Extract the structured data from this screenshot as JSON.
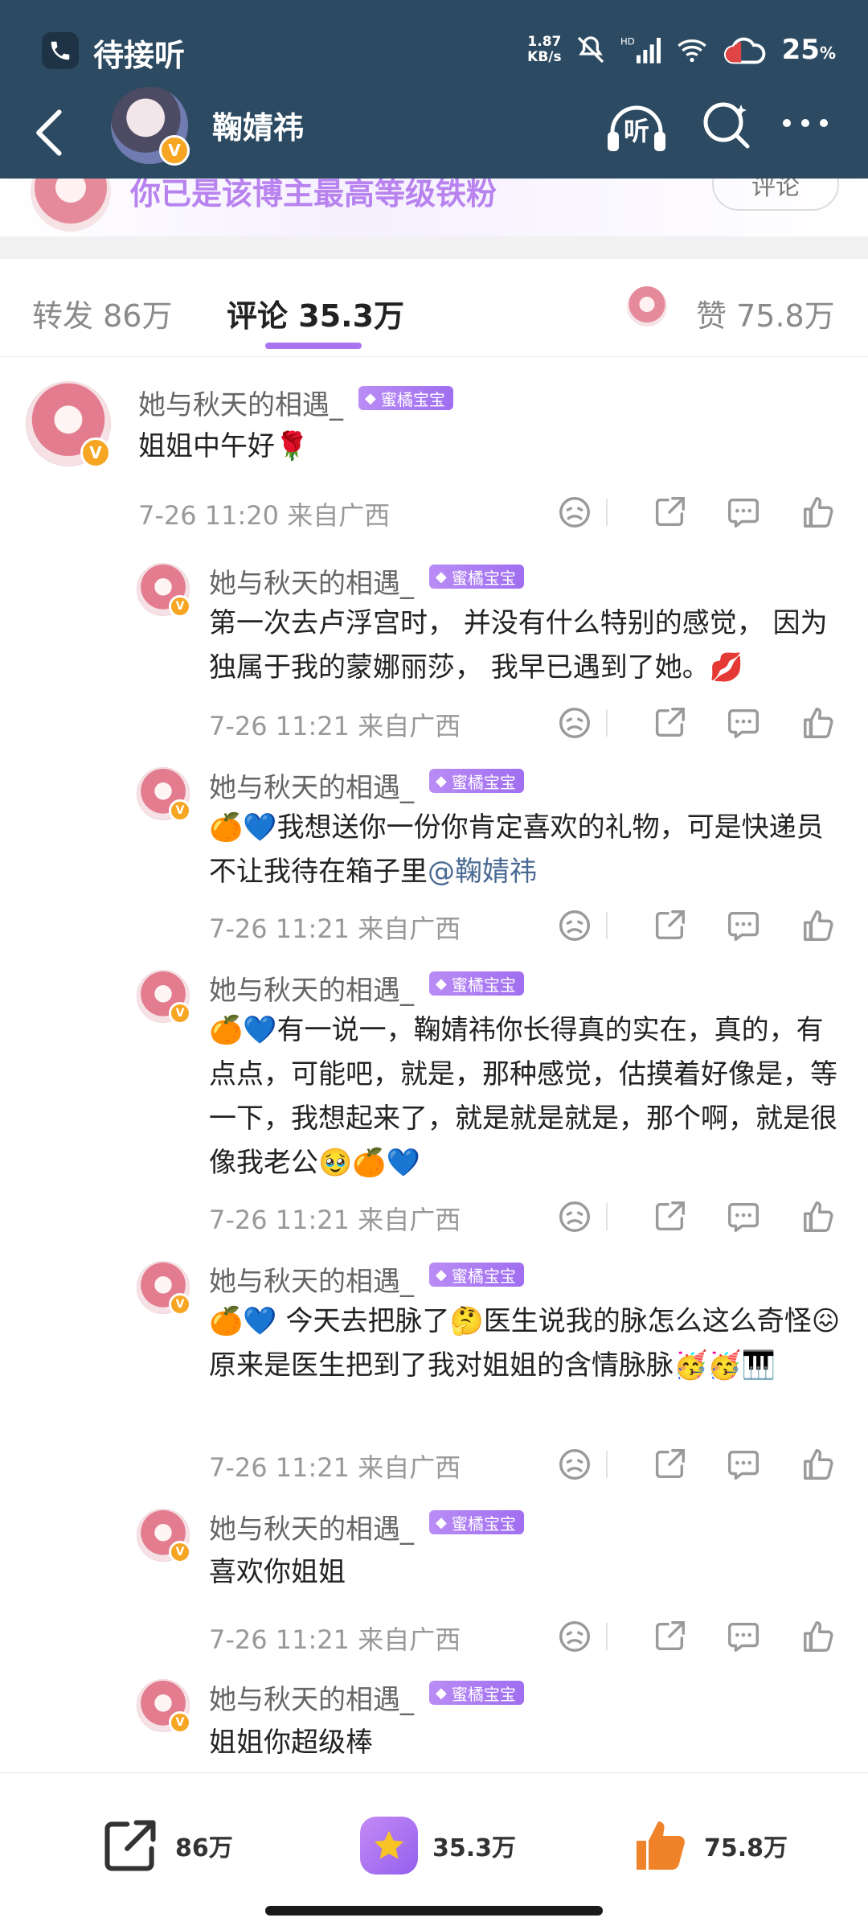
{
  "status_bar": {
    "call_text": "待接听",
    "speed_value": "1.87",
    "speed_unit": "KB/s",
    "battery": "25",
    "battery_unit": "%"
  },
  "header": {
    "username": "鞠婧祎",
    "listen_label": "听",
    "verified_badge": "V"
  },
  "fan_banner": {
    "text": "你已是该博主最高等级铁粉",
    "button": "评论"
  },
  "tabs": {
    "repost_label": "转发",
    "repost_count": "86万",
    "comment_label": "评论",
    "comment_count": "35.3万",
    "like_label": "赞",
    "like_count": "75.8万"
  },
  "comments": [
    {
      "user": "她与秋天的相遇_",
      "badge": "蜜橘宝宝",
      "text": "姐姐中午好🌹",
      "time": "7-26 11:20",
      "location": "来自广西"
    },
    {
      "user": "她与秋天的相遇_",
      "badge": "蜜橘宝宝",
      "text": "第一次去卢浮宫时， 并没有什么特别的感觉， 因为独属于我的蒙娜丽莎， 我早已遇到了她。💋",
      "time": "7-26 11:21",
      "location": "来自广西"
    },
    {
      "user": "她与秋天的相遇_",
      "badge": "蜜橘宝宝",
      "text": "🍊💙我想送你一份你肯定喜欢的礼物，可是快递员不让我待在箱子里",
      "mention": "@鞠婧祎",
      "time": "7-26 11:21",
      "location": "来自广西"
    },
    {
      "user": "她与秋天的相遇_",
      "badge": "蜜橘宝宝",
      "text": "🍊💙有一说一，鞠婧祎你长得真的实在，真的，有点点，可能吧，就是，那种感觉，估摸着好像是，等一下，我想起来了，就是就是就是，那个啊，就是很像我老公🥹🍊💙",
      "time": "7-26 11:21",
      "location": "来自广西"
    },
    {
      "user": "她与秋天的相遇_",
      "badge": "蜜橘宝宝",
      "text": "🍊💙 今天去把脉了🤔医生说我的脉怎么这么奇怪😖原来是医生把到了我对姐姐的含情脉脉🥳🥳🎹",
      "time": "7-26 11:21",
      "location": "来自广西"
    },
    {
      "user": "她与秋天的相遇_",
      "badge": "蜜橘宝宝",
      "text": "喜欢你姐姐",
      "time": "7-26 11:21",
      "location": "来自广西"
    },
    {
      "user": "她与秋天的相遇_",
      "badge": "蜜橘宝宝",
      "text": "姐姐你超级棒"
    }
  ],
  "bottom_bar": {
    "repost_count": "86万",
    "comment_count": "35.3万",
    "like_count": "75.8万"
  },
  "colors": {
    "header_bg": "#2c4a61",
    "accent_purple": "#a974f0",
    "mention_blue": "#4a6a94",
    "like_orange": "#f0832a"
  }
}
